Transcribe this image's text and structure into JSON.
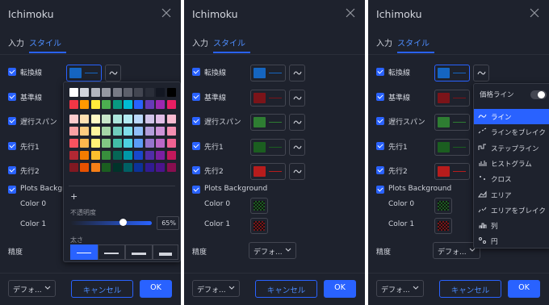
{
  "dialog": {
    "title": "Ichimoku",
    "tabs": [
      "入力",
      "スタイル"
    ],
    "rows": [
      "転換線",
      "基準線",
      "遅行スパン",
      "先行1",
      "先行2"
    ],
    "plots_bg": "Plots Background",
    "color0": "Color 0",
    "color1": "Color 1",
    "precision": "精度",
    "precision_value": "デフォ...",
    "template_value": "デフォ...",
    "cancel": "キャンセル",
    "ok": "OK"
  },
  "line_colors": [
    "#1565c0",
    "#7b1419",
    "#2e7d32",
    "#1b5e20",
    "#b71c1c"
  ],
  "cloud_colors": [
    "#1b5e20",
    "#7b1419"
  ],
  "picker": {
    "opacity_label": "不透明度",
    "opacity_value": "65%",
    "opacity_fraction": 0.65,
    "thickness_label": "太さ",
    "plus": "+"
  },
  "linestyle": {
    "price_line_label": "価格ライン",
    "items": [
      "ライン",
      "ラインをブレイク",
      "ステップライン",
      "ヒストグラム",
      "クロス",
      "エリア",
      "エリアをブレイク",
      "列",
      "円"
    ]
  },
  "colors": {
    "accent": "#2962ff",
    "panel_bg": "#1e222d",
    "text": "#d1d4dc"
  }
}
